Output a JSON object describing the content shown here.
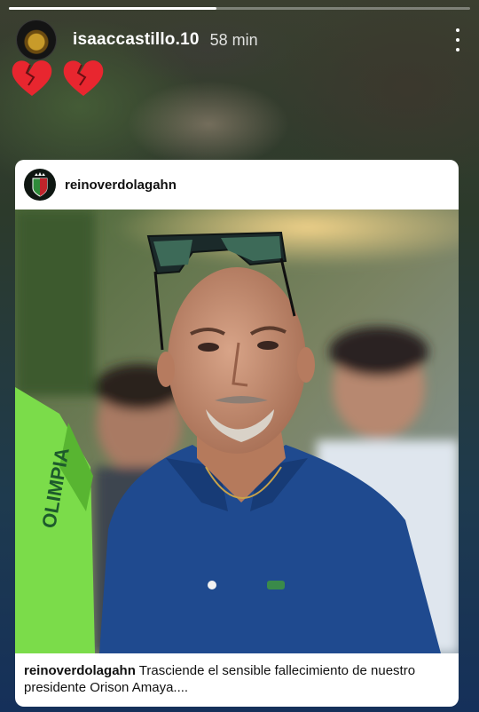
{
  "story": {
    "progress": 0.45,
    "username": "isaaccastillo.10",
    "time_ago": "58 min",
    "stickers": [
      "broken-heart",
      "broken-heart"
    ]
  },
  "post": {
    "account": "reinoverdolagahn",
    "caption_user": "reinoverdolagahn",
    "caption_text": "Trasciende el sensible fallecimiento de nuestro presidente Orison Amaya....",
    "jersey_text": "OLIMPIA"
  },
  "colors": {
    "card_bg": "#ffffff",
    "shirt": "#1f4a8f",
    "jersey": "#7bdc4a"
  }
}
